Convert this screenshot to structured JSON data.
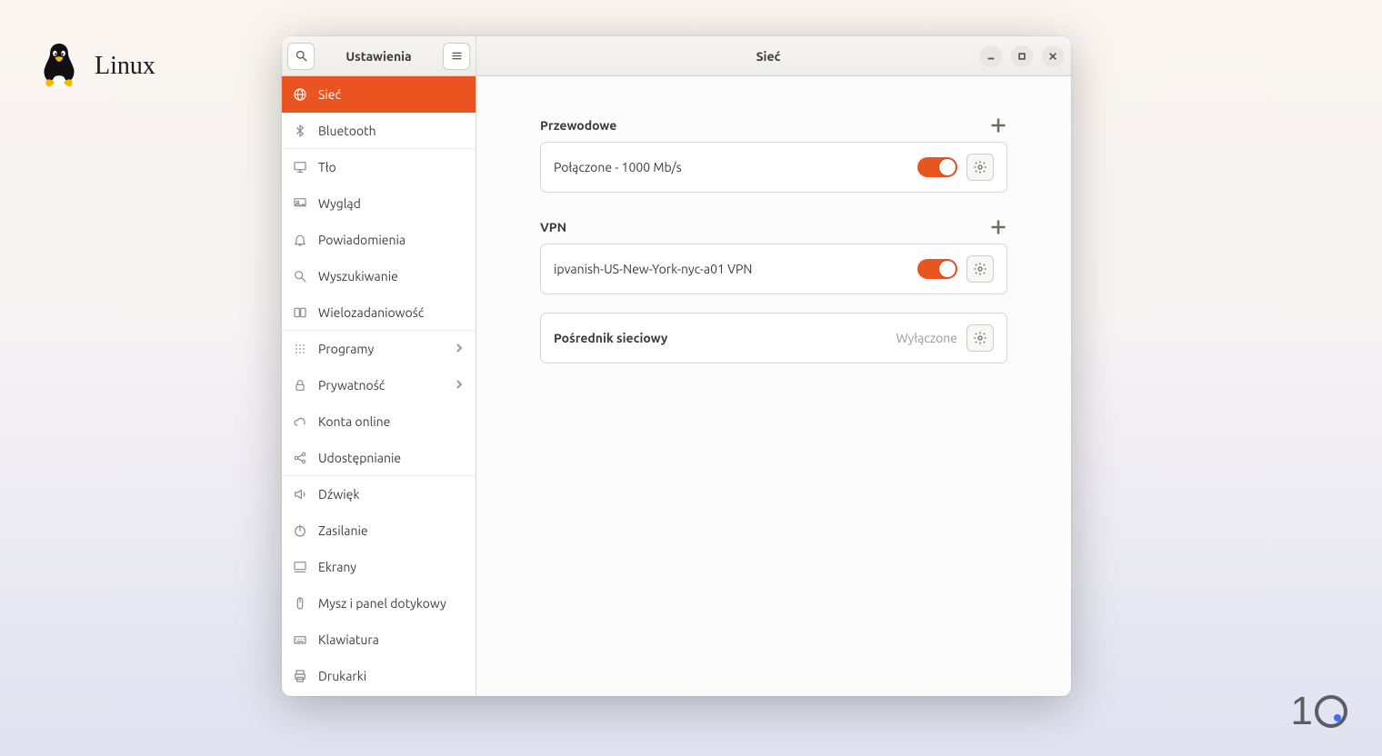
{
  "os_label": "Linux",
  "sidebar": {
    "title": "Ustawienia",
    "items": [
      {
        "id": "network",
        "label": "Sieć",
        "icon": "globe",
        "active": true,
        "sep": false,
        "chevron": false
      },
      {
        "id": "bluetooth",
        "label": "Bluetooth",
        "icon": "bluetooth",
        "active": false,
        "sep": true,
        "chevron": false
      },
      {
        "id": "background",
        "label": "Tło",
        "icon": "desktop",
        "active": false,
        "sep": false,
        "chevron": false
      },
      {
        "id": "appearance",
        "label": "Wygląd",
        "icon": "appearance",
        "active": false,
        "sep": false,
        "chevron": false
      },
      {
        "id": "notifications",
        "label": "Powiadomienia",
        "icon": "bell",
        "active": false,
        "sep": false,
        "chevron": false
      },
      {
        "id": "search",
        "label": "Wyszukiwanie",
        "icon": "search",
        "active": false,
        "sep": false,
        "chevron": false
      },
      {
        "id": "multitasking",
        "label": "Wielozadaniowość",
        "icon": "multitask",
        "active": false,
        "sep": true,
        "chevron": false
      },
      {
        "id": "apps",
        "label": "Programy",
        "icon": "grid",
        "active": false,
        "sep": false,
        "chevron": true
      },
      {
        "id": "privacy",
        "label": "Prywatność",
        "icon": "lock",
        "active": false,
        "sep": false,
        "chevron": true
      },
      {
        "id": "online",
        "label": "Konta online",
        "icon": "cloud",
        "active": false,
        "sep": false,
        "chevron": false
      },
      {
        "id": "sharing",
        "label": "Udostępnianie",
        "icon": "share",
        "active": false,
        "sep": true,
        "chevron": false
      },
      {
        "id": "sound",
        "label": "Dźwięk",
        "icon": "sound",
        "active": false,
        "sep": false,
        "chevron": false
      },
      {
        "id": "power",
        "label": "Zasilanie",
        "icon": "power",
        "active": false,
        "sep": false,
        "chevron": false
      },
      {
        "id": "displays",
        "label": "Ekrany",
        "icon": "display",
        "active": false,
        "sep": false,
        "chevron": false
      },
      {
        "id": "mouse",
        "label": "Mysz i panel dotykowy",
        "icon": "mouse",
        "active": false,
        "sep": false,
        "chevron": false
      },
      {
        "id": "keyboard",
        "label": "Klawiatura",
        "icon": "keyboard",
        "active": false,
        "sep": false,
        "chevron": false
      },
      {
        "id": "printers",
        "label": "Drukarki",
        "icon": "printer",
        "active": false,
        "sep": false,
        "chevron": false
      }
    ]
  },
  "main": {
    "title": "Sieć",
    "wired_section": "Przewodowe",
    "wired_label": "Połączone - 1000 Mb/s",
    "wired_on": true,
    "vpn_section": "VPN",
    "vpn_label": "ipvanish-US-New-York-nyc-a01 VPN",
    "vpn_on": true,
    "proxy_label": "Pośrednik sieciowy",
    "proxy_status": "Wyłączone"
  },
  "colors": {
    "accent": "#E95420"
  }
}
